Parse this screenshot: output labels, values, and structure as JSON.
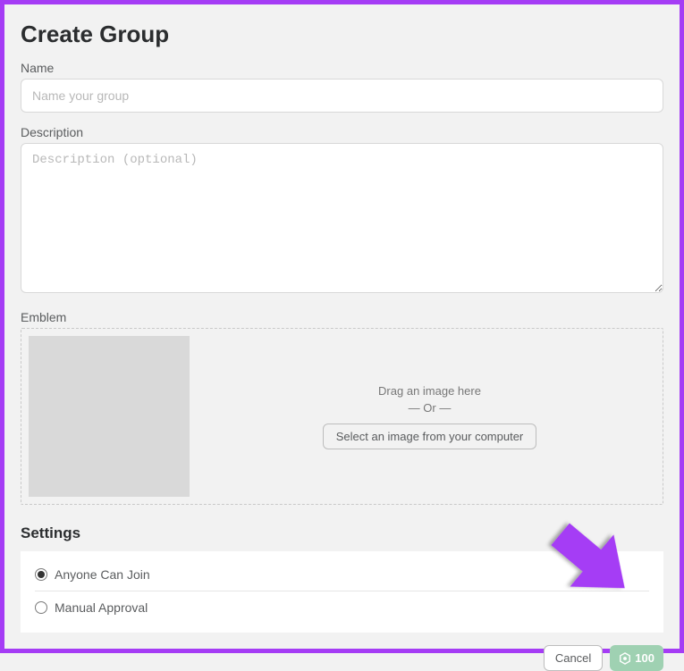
{
  "title": "Create Group",
  "name": {
    "label": "Name",
    "placeholder": "Name your group",
    "value": ""
  },
  "description": {
    "label": "Description",
    "placeholder": "Description (optional)",
    "value": ""
  },
  "emblem": {
    "label": "Emblem",
    "drag_text": "Drag an image here",
    "or_text": "— Or —",
    "select_button": "Select an image from your computer"
  },
  "settings": {
    "title": "Settings",
    "options": [
      {
        "label": "Anyone Can Join",
        "selected": true
      },
      {
        "label": "Manual Approval",
        "selected": false
      }
    ]
  },
  "footer": {
    "cancel": "Cancel",
    "cost": "100"
  },
  "colors": {
    "annotation_arrow": "#a53cf5",
    "cost_button_bg": "#9fd1b2"
  }
}
